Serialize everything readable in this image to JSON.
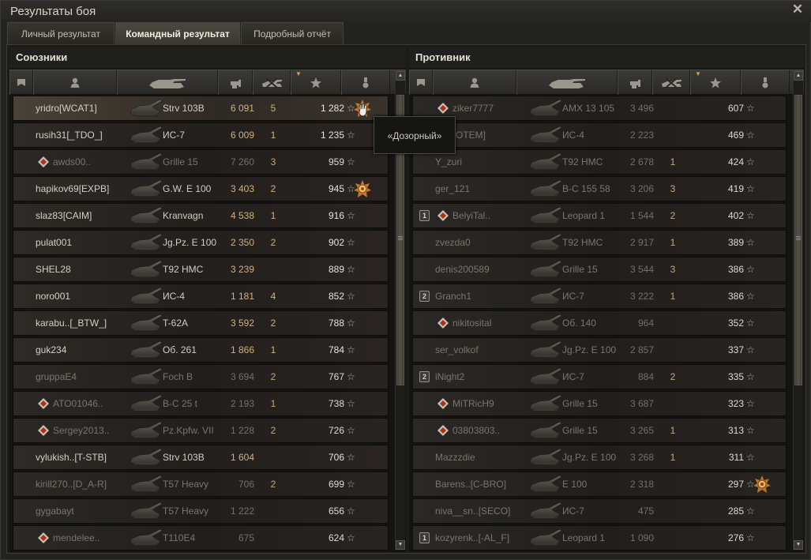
{
  "window": {
    "title": "Результаты боя"
  },
  "tabs": [
    {
      "label": "Личный результат",
      "active": false
    },
    {
      "label": "Командный результат",
      "active": true
    },
    {
      "label": "Подробный отчёт",
      "active": false
    }
  ],
  "allies": {
    "title": "Союзники",
    "rows": [
      {
        "name": "yridro[WCAT1]",
        "tank": "Strv 103B",
        "damage": "6 091",
        "frags": "5",
        "xp": "1 282",
        "platoon": "",
        "clan_icon": false,
        "medal": "top-gun-medal",
        "alive": true,
        "highlight": true
      },
      {
        "name": "rusih31[_TDO_]",
        "tank": "ИС-7",
        "damage": "6 009",
        "frags": "1",
        "xp": "1 235",
        "platoon": "",
        "clan_icon": false,
        "medal": "",
        "alive": true,
        "highlight": false
      },
      {
        "name": "awds00..",
        "tank": "Grille 15",
        "damage": "7 260",
        "frags": "3",
        "xp": "959",
        "platoon": "",
        "clan_icon": true,
        "medal": "",
        "alive": false,
        "highlight": false
      },
      {
        "name": "hapikov69[EXPB]",
        "tank": "G.W. E 100",
        "damage": "3 403",
        "frags": "2",
        "xp": "945",
        "platoon": "",
        "clan_icon": false,
        "medal": "scout-medal",
        "alive": true,
        "highlight": false
      },
      {
        "name": "slaz83[CAIM]",
        "tank": "Kranvagn",
        "damage": "4 538",
        "frags": "1",
        "xp": "916",
        "platoon": "",
        "clan_icon": false,
        "medal": "",
        "alive": true,
        "highlight": false
      },
      {
        "name": "pulat001",
        "tank": "Jg.Pz. E 100",
        "damage": "2 350",
        "frags": "2",
        "xp": "902",
        "platoon": "",
        "clan_icon": false,
        "medal": "",
        "alive": true,
        "highlight": false
      },
      {
        "name": "SHEL28",
        "tank": "T92 HMC",
        "damage": "3 239",
        "frags": "",
        "xp": "889",
        "platoon": "",
        "clan_icon": false,
        "medal": "",
        "alive": true,
        "highlight": false
      },
      {
        "name": "noro001",
        "tank": "ИС-4",
        "damage": "1 181",
        "frags": "4",
        "xp": "852",
        "platoon": "",
        "clan_icon": false,
        "medal": "",
        "alive": true,
        "highlight": false
      },
      {
        "name": "karabu..[_BTW_]",
        "tank": "T-62A",
        "damage": "3 592",
        "frags": "2",
        "xp": "788",
        "platoon": "",
        "clan_icon": false,
        "medal": "",
        "alive": true,
        "highlight": false
      },
      {
        "name": "guk234",
        "tank": "Об. 261",
        "damage": "1 866",
        "frags": "1",
        "xp": "784",
        "platoon": "",
        "clan_icon": false,
        "medal": "",
        "alive": true,
        "highlight": false
      },
      {
        "name": "gruppaE4",
        "tank": "Foch B",
        "damage": "3 694",
        "frags": "2",
        "xp": "767",
        "platoon": "",
        "clan_icon": false,
        "medal": "",
        "alive": false,
        "highlight": false
      },
      {
        "name": "ATO01046..",
        "tank": "B-C 25 t",
        "damage": "2 193",
        "frags": "1",
        "xp": "738",
        "platoon": "",
        "clan_icon": true,
        "medal": "",
        "alive": false,
        "highlight": false
      },
      {
        "name": "Sergey2013..",
        "tank": "Pz.Kpfw. VII",
        "damage": "1 228",
        "frags": "2",
        "xp": "726",
        "platoon": "",
        "clan_icon": true,
        "medal": "",
        "alive": false,
        "highlight": false
      },
      {
        "name": "vylukish..[T-STB]",
        "tank": "Strv 103B",
        "damage": "1 604",
        "frags": "",
        "xp": "706",
        "platoon": "",
        "clan_icon": false,
        "medal": "",
        "alive": true,
        "highlight": false
      },
      {
        "name": "kirill270..[D_A-R]",
        "tank": "T57 Heavy",
        "damage": "706",
        "frags": "2",
        "xp": "699",
        "platoon": "",
        "clan_icon": false,
        "medal": "",
        "alive": false,
        "highlight": false
      },
      {
        "name": "gygabayt",
        "tank": "T57 Heavy",
        "damage": "1 222",
        "frags": "",
        "xp": "656",
        "platoon": "",
        "clan_icon": false,
        "medal": "",
        "alive": false,
        "highlight": false
      },
      {
        "name": "mendelee..",
        "tank": "T110E4",
        "damage": "675",
        "frags": "",
        "xp": "624",
        "platoon": "",
        "clan_icon": true,
        "medal": "",
        "alive": false,
        "highlight": false
      }
    ]
  },
  "enemies": {
    "title": "Противник",
    "rows": [
      {
        "name": "ziker7777",
        "tank": "AMX 13 105",
        "damage": "3 496",
        "frags": "",
        "xp": "607",
        "platoon": "",
        "clan_icon": true,
        "medal": "",
        "alive": false,
        "highlight": false
      },
      {
        "name": "d..[GOTEM]",
        "tank": "ИС-4",
        "damage": "2 223",
        "frags": "",
        "xp": "469",
        "platoon": "",
        "clan_icon": false,
        "medal": "",
        "alive": false,
        "highlight": false
      },
      {
        "name": "Y_zuri",
        "tank": "T92 HMC",
        "damage": "2 678",
        "frags": "1",
        "xp": "424",
        "platoon": "",
        "clan_icon": false,
        "medal": "",
        "alive": false,
        "highlight": false
      },
      {
        "name": "ger_121",
        "tank": "B-C 155 58",
        "damage": "3 206",
        "frags": "3",
        "xp": "419",
        "platoon": "",
        "clan_icon": false,
        "medal": "",
        "alive": false,
        "highlight": false
      },
      {
        "name": "BelyiTal..",
        "tank": "Leopard 1",
        "damage": "1 544",
        "frags": "2",
        "xp": "402",
        "platoon": "1",
        "clan_icon": true,
        "medal": "",
        "alive": false,
        "highlight": false
      },
      {
        "name": "zvezda0",
        "tank": "T92 HMC",
        "damage": "2 917",
        "frags": "1",
        "xp": "389",
        "platoon": "",
        "clan_icon": false,
        "medal": "",
        "alive": false,
        "highlight": false
      },
      {
        "name": "denis200589",
        "tank": "Grille 15",
        "damage": "3 544",
        "frags": "3",
        "xp": "386",
        "platoon": "",
        "clan_icon": false,
        "medal": "",
        "alive": false,
        "highlight": false
      },
      {
        "name": "Granch1",
        "tank": "ИС-7",
        "damage": "3 222",
        "frags": "1",
        "xp": "386",
        "platoon": "2",
        "clan_icon": false,
        "medal": "",
        "alive": false,
        "highlight": false
      },
      {
        "name": "nikitosital",
        "tank": "Об. 140",
        "damage": "964",
        "frags": "",
        "xp": "352",
        "platoon": "",
        "clan_icon": true,
        "medal": "",
        "alive": false,
        "highlight": false
      },
      {
        "name": "ser_volkof",
        "tank": "Jg.Pz. E 100",
        "damage": "2 857",
        "frags": "",
        "xp": "337",
        "platoon": "",
        "clan_icon": false,
        "medal": "",
        "alive": false,
        "highlight": false
      },
      {
        "name": "iNight2",
        "tank": "ИС-7",
        "damage": "884",
        "frags": "2",
        "xp": "335",
        "platoon": "2",
        "clan_icon": false,
        "medal": "",
        "alive": false,
        "highlight": false
      },
      {
        "name": "MiTRicH9",
        "tank": "Grille 15",
        "damage": "3 687",
        "frags": "",
        "xp": "323",
        "platoon": "",
        "clan_icon": true,
        "medal": "",
        "alive": false,
        "highlight": false
      },
      {
        "name": "03803803..",
        "tank": "Grille 15",
        "damage": "3 265",
        "frags": "1",
        "xp": "313",
        "platoon": "",
        "clan_icon": true,
        "medal": "",
        "alive": false,
        "highlight": false
      },
      {
        "name": "Mazzzdie",
        "tank": "Jg.Pz. E 100",
        "damage": "3 268",
        "frags": "1",
        "xp": "311",
        "platoon": "",
        "clan_icon": false,
        "medal": "",
        "alive": false,
        "highlight": false
      },
      {
        "name": "Barens..[C-BRO]",
        "tank": "E 100",
        "damage": "2 318",
        "frags": "",
        "xp": "297",
        "platoon": "",
        "clan_icon": false,
        "medal": "scout-medal",
        "alive": false,
        "highlight": false
      },
      {
        "name": "niva__sn..[SECO]",
        "tank": "ИС-7",
        "damage": "475",
        "frags": "",
        "xp": "285",
        "platoon": "",
        "clan_icon": false,
        "medal": "",
        "alive": false,
        "highlight": false
      },
      {
        "name": "kozyrenk..[-AL_F]",
        "tank": "Leopard 1",
        "damage": "1 090",
        "frags": "",
        "xp": "276",
        "platoon": "1",
        "clan_icon": false,
        "medal": "",
        "alive": false,
        "highlight": false
      }
    ]
  },
  "tooltip": {
    "text": "«Дозорный»"
  },
  "icons": {
    "close": "close-icon",
    "columns": [
      "platoon-icon",
      "player-icon",
      "tank-icon",
      "damage-icon",
      "frags-icon",
      "xp-star-icon",
      "medal-icon"
    ],
    "xp_star": "☆"
  },
  "colors": {
    "accent": "#d2b27a",
    "sort_marker": "#c8a14a"
  }
}
